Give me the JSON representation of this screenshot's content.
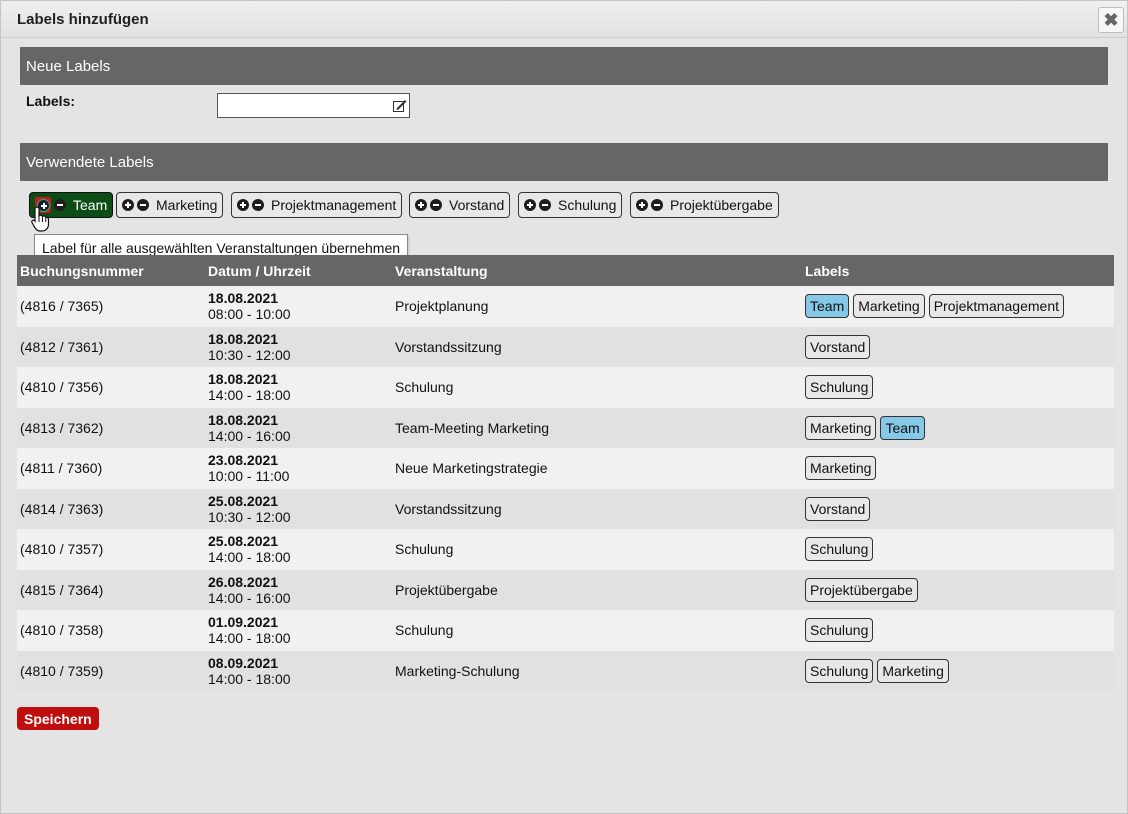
{
  "dialog": {
    "title": "Labels hinzufügen",
    "close_glyph": "✖"
  },
  "new_labels": {
    "section_title": "Neue Labels",
    "field_label": "Labels:",
    "field_value": "",
    "field_icon": "edit-icon"
  },
  "used_labels": {
    "section_title": "Verwendete Labels",
    "chips": [
      {
        "label": "Team",
        "active": true
      },
      {
        "label": "Marketing",
        "active": false
      },
      {
        "label": "Projektmanagement",
        "active": false
      },
      {
        "label": "Vorstand",
        "active": false
      },
      {
        "label": "Schulung",
        "active": false
      },
      {
        "label": "Projektübergabe",
        "active": false
      }
    ],
    "tooltip": "Label für alle ausgewählten Veranstaltungen übernehmen"
  },
  "table": {
    "columns": [
      "Buchungsnummer",
      "Datum / Uhrzeit",
      "Veranstaltung",
      "Labels"
    ],
    "rows": [
      {
        "booking": "(4816 / 7365)",
        "date": "18.08.2021",
        "time": "08:00 - 10:00",
        "event": "Projektplanung",
        "labels": [
          {
            "text": "Team",
            "highlight": true
          },
          {
            "text": "Marketing",
            "highlight": false
          },
          {
            "text": "Projektmanagement",
            "highlight": false
          }
        ]
      },
      {
        "booking": "(4812 / 7361)",
        "date": "18.08.2021",
        "time": "10:30 - 12:00",
        "event": "Vorstandssitzung",
        "labels": [
          {
            "text": "Vorstand",
            "highlight": false
          }
        ]
      },
      {
        "booking": "(4810 / 7356)",
        "date": "18.08.2021",
        "time": "14:00 - 18:00",
        "event": "Schulung",
        "labels": [
          {
            "text": "Schulung",
            "highlight": false
          }
        ]
      },
      {
        "booking": "(4813 / 7362)",
        "date": "18.08.2021",
        "time": "14:00 - 16:00",
        "event": "Team-Meeting Marketing",
        "labels": [
          {
            "text": "Marketing",
            "highlight": false
          },
          {
            "text": "Team",
            "highlight": true
          }
        ]
      },
      {
        "booking": "(4811 / 7360)",
        "date": "23.08.2021",
        "time": "10:00 - 11:00",
        "event": "Neue Marketingstrategie",
        "labels": [
          {
            "text": "Marketing",
            "highlight": false
          }
        ]
      },
      {
        "booking": "(4814 / 7363)",
        "date": "25.08.2021",
        "time": "10:30 - 12:00",
        "event": "Vorstandssitzung",
        "labels": [
          {
            "text": "Vorstand",
            "highlight": false
          }
        ]
      },
      {
        "booking": "(4810 / 7357)",
        "date": "25.08.2021",
        "time": "14:00 - 18:00",
        "event": "Schulung",
        "labels": [
          {
            "text": "Schulung",
            "highlight": false
          }
        ]
      },
      {
        "booking": "(4815 / 7364)",
        "date": "26.08.2021",
        "time": "14:00 - 16:00",
        "event": "Projektübergabe",
        "labels": [
          {
            "text": "Projektübergabe",
            "highlight": false
          }
        ]
      },
      {
        "booking": "(4810 / 7358)",
        "date": "01.09.2021",
        "time": "14:00 - 18:00",
        "event": "Schulung",
        "labels": [
          {
            "text": "Schulung",
            "highlight": false
          }
        ]
      },
      {
        "booking": "(4810 / 7359)",
        "date": "08.09.2021",
        "time": "14:00 - 18:00",
        "event": "Marketing-Schulung",
        "labels": [
          {
            "text": "Schulung",
            "highlight": false
          },
          {
            "text": "Marketing",
            "highlight": false
          }
        ]
      }
    ]
  },
  "actions": {
    "save_label": "Speichern"
  },
  "colors": {
    "section_header": "#666666",
    "active_chip": "#0c4d16",
    "highlight_tag": "#85c8e8",
    "save_button": "#c00d0d"
  }
}
